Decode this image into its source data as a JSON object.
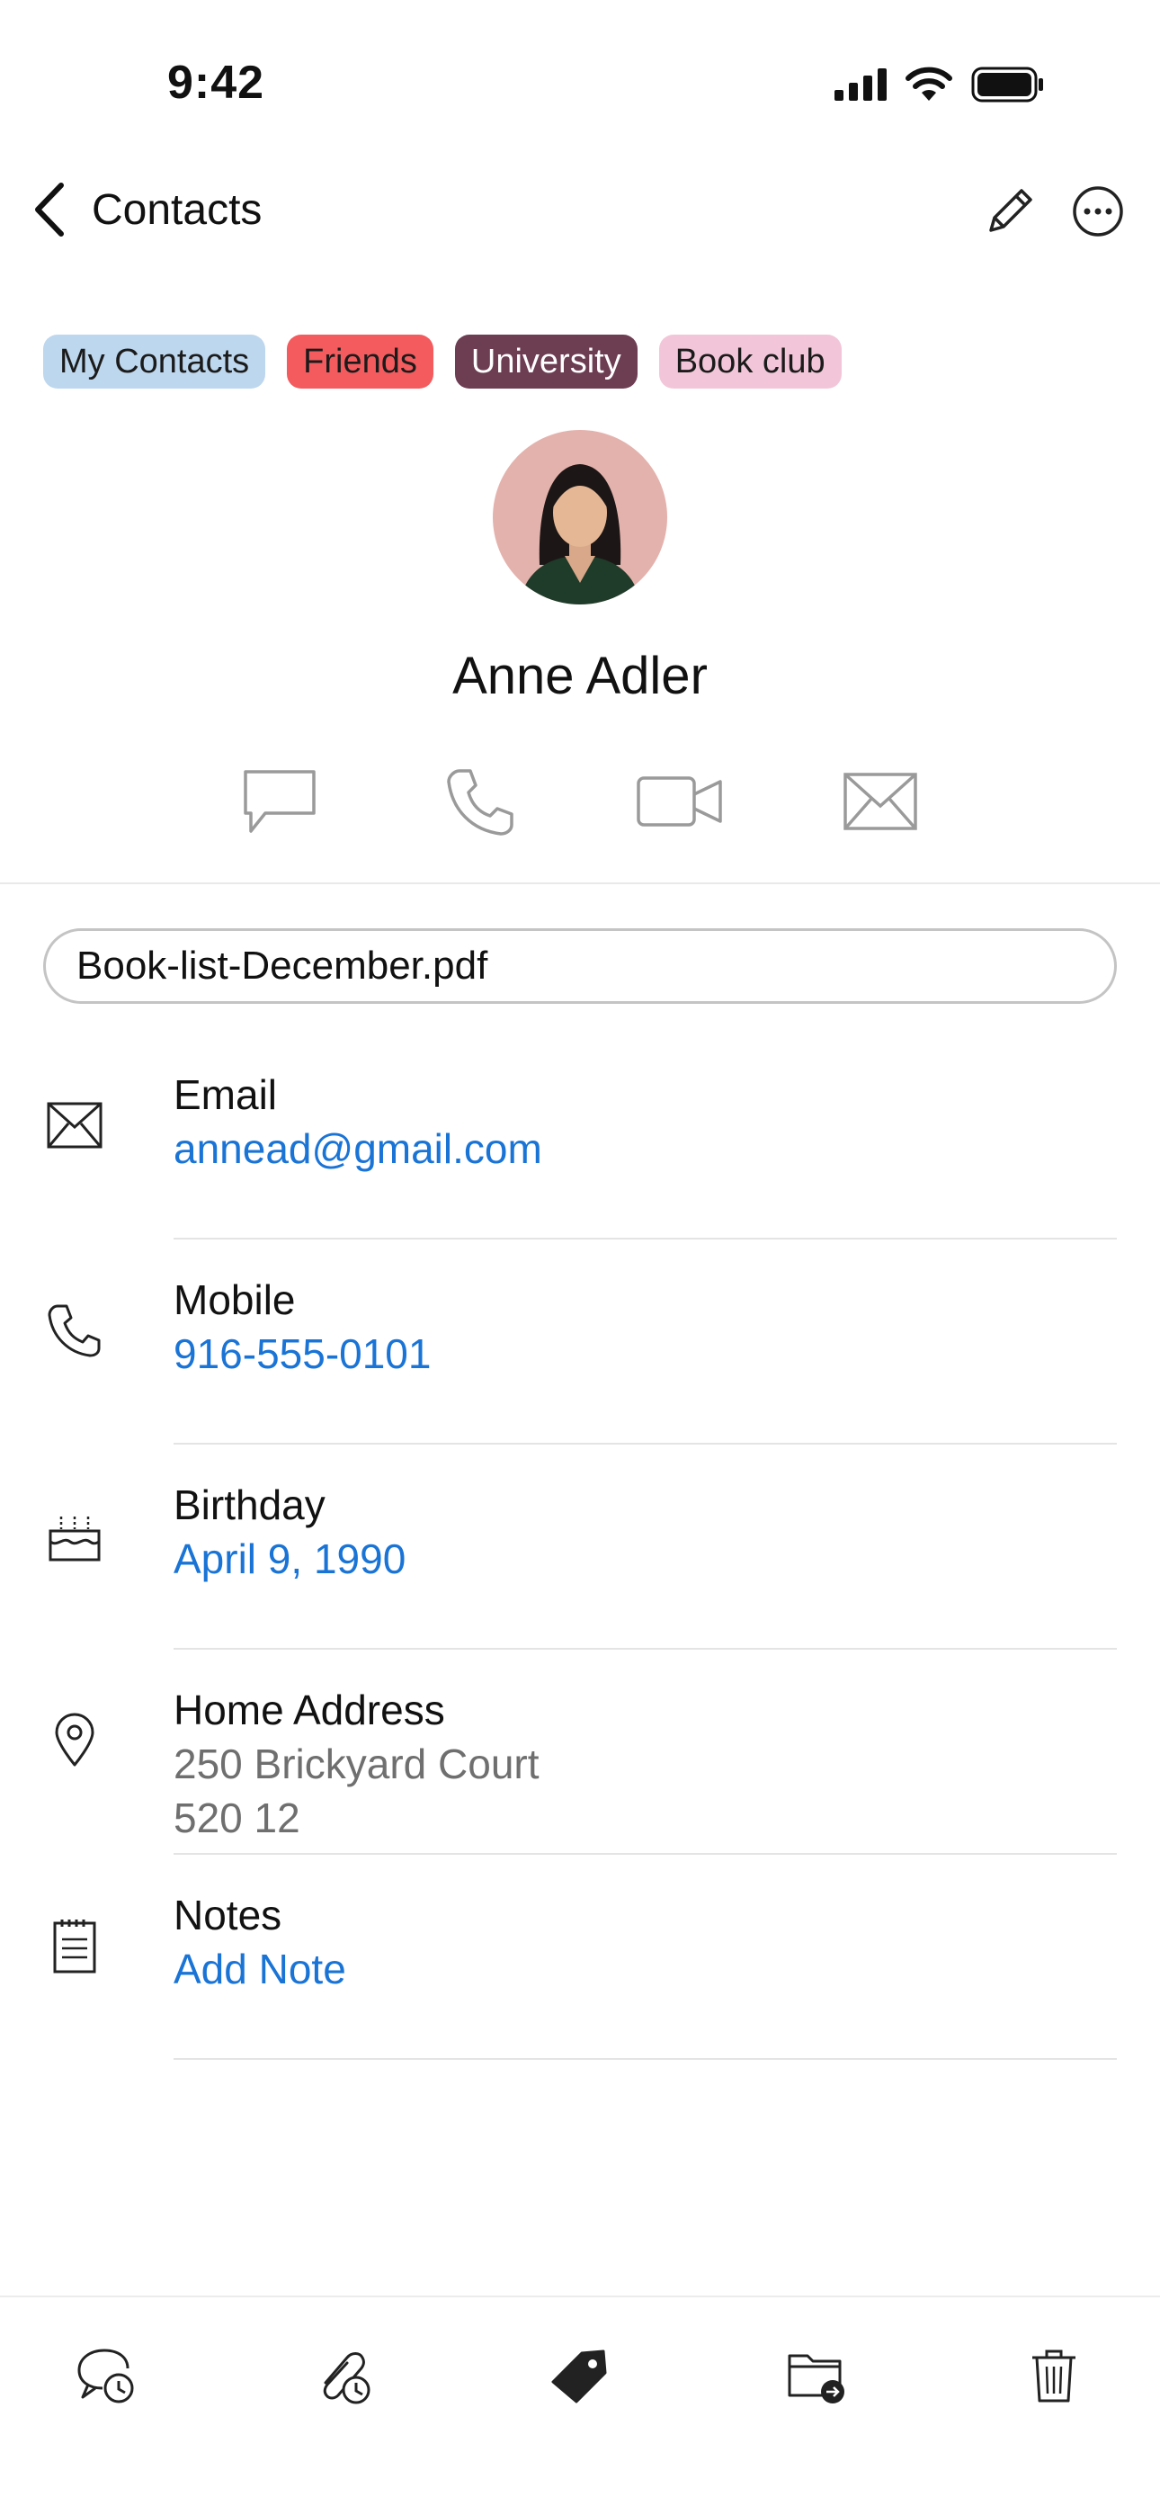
{
  "status_bar": {
    "time": "9:42",
    "icons": [
      "cellular-signal-icon",
      "wifi-icon",
      "battery-icon"
    ]
  },
  "nav": {
    "back_label": "Contacts",
    "back_icon": "chevron-left-icon",
    "edit_icon": "pencil-icon",
    "more_icon": "ellipsis-circle-icon"
  },
  "tags": [
    {
      "label": "My Contacts",
      "bg": "#bdd7ee",
      "color": "#1b1b1b"
    },
    {
      "label": "Friends",
      "bg": "#f35b5e",
      "color": "#1b1b1b"
    },
    {
      "label": "University",
      "bg": "#6d3d52",
      "color": "#ffffff"
    },
    {
      "label": "Book club",
      "bg": "#f2c6d8",
      "color": "#1b1b1b"
    }
  ],
  "contact": {
    "name": "Anne Adler",
    "avatar_bg": "#e4b2ad"
  },
  "actions": [
    {
      "name": "message-icon"
    },
    {
      "name": "phone-icon"
    },
    {
      "name": "video-icon"
    },
    {
      "name": "mail-icon"
    }
  ],
  "attachment": {
    "filename": "Book-list-December.pdf"
  },
  "fields": {
    "email": {
      "label": "Email",
      "value": "annead@gmail.com",
      "icon": "envelope-icon"
    },
    "mobile": {
      "label": "Mobile",
      "value": "916-555-0101",
      "icon": "phone-icon"
    },
    "birthday": {
      "label": "Birthday",
      "value": "April 9, 1990",
      "icon": "birthday-cake-icon"
    },
    "address": {
      "label": "Home Address",
      "line1": "250 Brickyard Court",
      "line2": "520 12",
      "icon": "map-pin-icon"
    },
    "notes": {
      "label": "Notes",
      "value": "Add Note",
      "icon": "notepad-icon"
    }
  },
  "toolbar": [
    {
      "name": "chat-history-icon"
    },
    {
      "name": "attachment-history-icon"
    },
    {
      "name": "tag-icon"
    },
    {
      "name": "move-to-folder-icon"
    },
    {
      "name": "trash-icon"
    }
  ],
  "colors": {
    "link": "#1a74d6",
    "muted_text": "#6f6f6f",
    "icon_gray": "#9a9a9a"
  }
}
